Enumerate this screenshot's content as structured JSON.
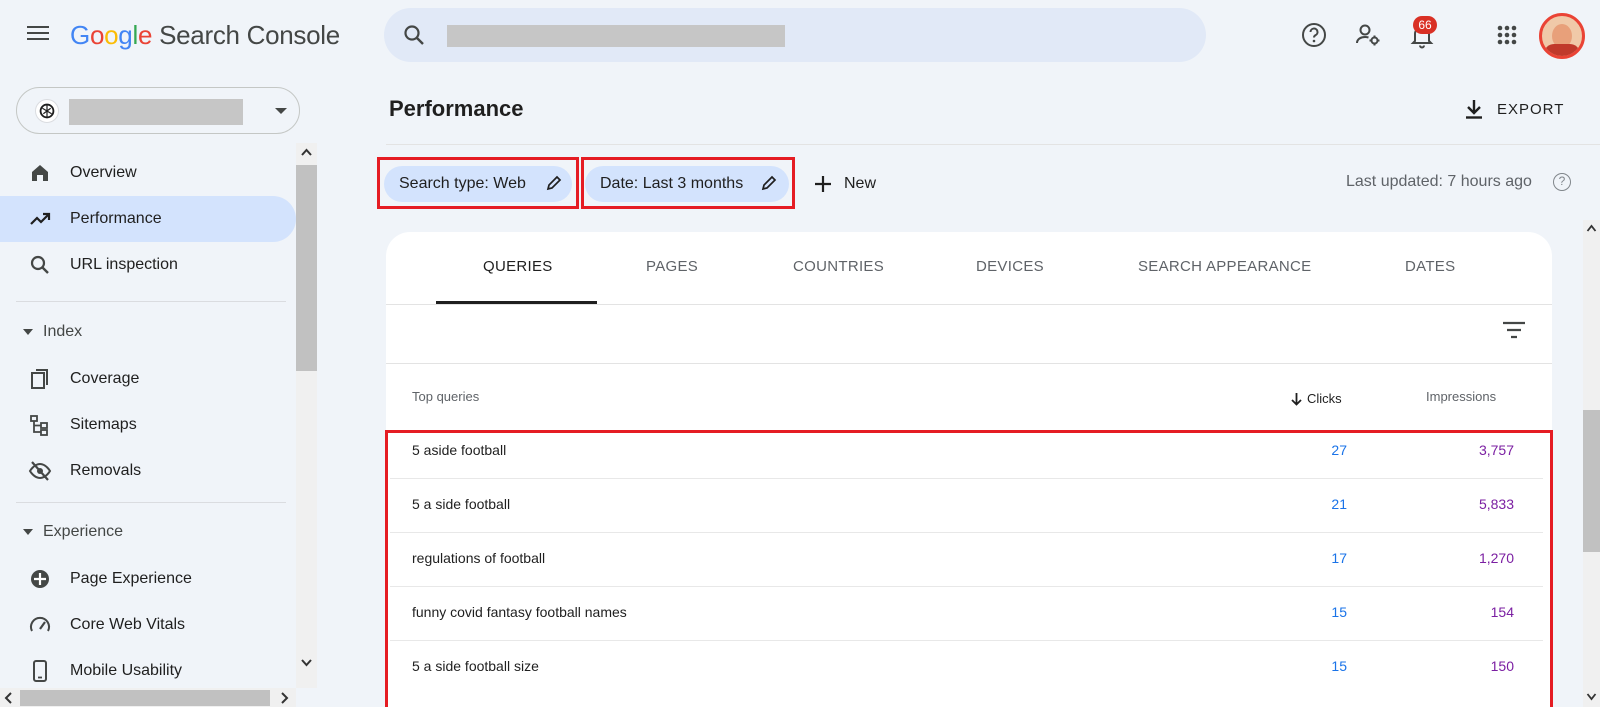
{
  "app": {
    "logo_letters": [
      "G",
      "o",
      "o",
      "g",
      "l",
      "e"
    ],
    "product": "Search Console",
    "notification_count": "66"
  },
  "sidebar": {
    "items": [
      {
        "label": "Overview",
        "icon": "home-icon"
      },
      {
        "label": "Performance",
        "icon": "trending-up-icon",
        "active": true
      },
      {
        "label": "URL inspection",
        "icon": "search-icon"
      }
    ],
    "sections": [
      {
        "title": "Index",
        "items": [
          {
            "label": "Coverage",
            "icon": "coverage-icon"
          },
          {
            "label": "Sitemaps",
            "icon": "sitemap-icon"
          },
          {
            "label": "Removals",
            "icon": "eye-off-icon"
          }
        ]
      },
      {
        "title": "Experience",
        "items": [
          {
            "label": "Page Experience",
            "icon": "page-experience-icon"
          },
          {
            "label": "Core Web Vitals",
            "icon": "speedometer-icon"
          },
          {
            "label": "Mobile Usability",
            "icon": "phone-icon"
          }
        ]
      }
    ]
  },
  "main": {
    "title": "Performance",
    "export_label": "EXPORT",
    "filters": {
      "search_type": "Search type: Web",
      "date": "Date: Last 3 months",
      "new_label": "New"
    },
    "last_updated": "Last updated: 7 hours ago",
    "help_glyph": "?",
    "tabs": [
      "QUERIES",
      "PAGES",
      "COUNTRIES",
      "DEVICES",
      "SEARCH APPEARANCE",
      "DATES"
    ],
    "active_tab": "QUERIES",
    "table": {
      "headers": {
        "query": "Top queries",
        "clicks": "Clicks",
        "impressions": "Impressions"
      },
      "rows": [
        {
          "query": "5 aside football",
          "clicks": "27",
          "impressions": "3,757"
        },
        {
          "query": "5 a side football",
          "clicks": "21",
          "impressions": "5,833"
        },
        {
          "query": "regulations of football",
          "clicks": "17",
          "impressions": "1,270"
        },
        {
          "query": "funny covid fantasy football names",
          "clicks": "15",
          "impressions": "154"
        },
        {
          "query": "5 a side football size",
          "clicks": "15",
          "impressions": "150"
        }
      ]
    }
  },
  "colors": {
    "accent": "#d3e3fd",
    "clicks": "#1a73e8",
    "impressions": "#7b1fa2",
    "highlight": "#e51c23",
    "badge": "#d93025"
  }
}
